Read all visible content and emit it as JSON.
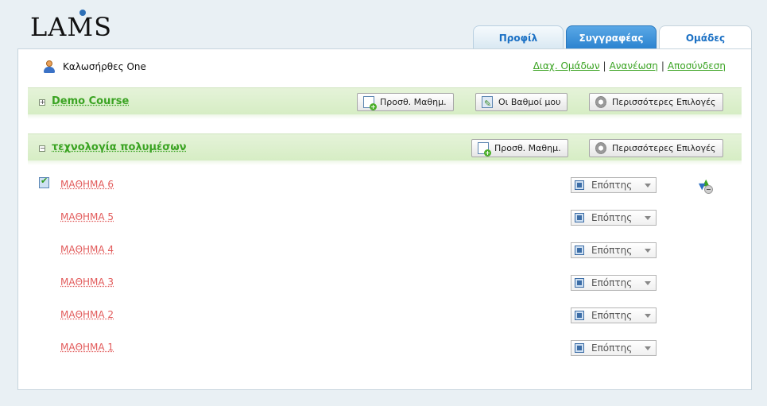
{
  "app": {
    "logo_text": "LAMS"
  },
  "tabs": [
    {
      "label": "Προφίλ"
    },
    {
      "label": "Συγγραφέας"
    },
    {
      "label": "Ομάδες"
    }
  ],
  "user": {
    "welcome": "Καλωσήρθες One"
  },
  "top_links": [
    {
      "label": "Διαχ. Ομάδων"
    },
    {
      "label": "Ανανέωση"
    },
    {
      "label": "Αποσύνδεση"
    }
  ],
  "courses": [
    {
      "title": "Demo Course",
      "toggle": "+",
      "buttons": {
        "add_lesson": "Προσθ. Μαθημ.",
        "my_grades": "Οι Βαθμοί μου",
        "more_options": "Περισσότερες Επιλογές"
      }
    },
    {
      "title": "τεχνολογία πολυμέσων",
      "toggle": "−",
      "buttons": {
        "add_lesson": "Προσθ. Μαθημ.",
        "more_options": "Περισσότερες Επιλογές"
      },
      "lessons": [
        {
          "name": "ΜΑΘΗΜΑ 6",
          "role": "Επόπτης"
        },
        {
          "name": "ΜΑΘΗΜΑ 5",
          "role": "Επόπτης"
        },
        {
          "name": "ΜΑΘΗΜΑ 4",
          "role": "Επόπτης"
        },
        {
          "name": "ΜΑΘΗΜΑ 3",
          "role": "Επόπτης"
        },
        {
          "name": "ΜΑΘΗΜΑ 2",
          "role": "Επόπτης"
        },
        {
          "name": "ΜΑΘΗΜΑ 1",
          "role": "Επόπτης"
        }
      ]
    }
  ],
  "colors": {
    "accent_green": "#3aa322",
    "lesson_link": "#e25b5b",
    "tab_active_blue": "#2a82cf"
  }
}
